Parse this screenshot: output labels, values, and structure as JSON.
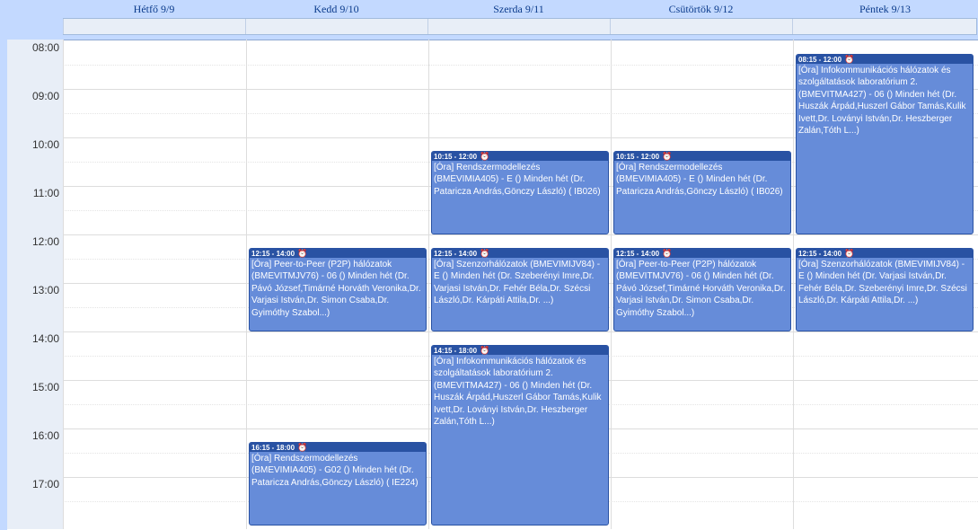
{
  "days": [
    {
      "label": "Hétfő 9/9"
    },
    {
      "label": "Kedd 9/10"
    },
    {
      "label": "Szerda 9/11"
    },
    {
      "label": "Csütörtök 9/12"
    },
    {
      "label": "Péntek 9/13"
    }
  ],
  "hours": [
    "08:00",
    "09:00",
    "10:00",
    "11:00",
    "12:00",
    "13:00",
    "14:00",
    "15:00",
    "16:00",
    "17:00"
  ],
  "events": [
    {
      "day": 4,
      "start": "08:15",
      "end": "12:00",
      "time": "08:15 - 12:00",
      "icon": "alarm-clock-icon",
      "text": "[Óra] Infokommunikációs hálózatok és szolgáltatások laboratórium 2. (BMEVITMA427) - 06 () Minden hét (Dr. Huszák Árpád,Huszerl Gábor Tamás,Kulik Ivett,Dr. Loványi István,Dr. Heszberger Zalán,Tóth L...)"
    },
    {
      "day": 2,
      "start": "10:15",
      "end": "12:00",
      "time": "10:15 - 12:00",
      "icon": "alarm-clock-icon",
      "text": "[Óra] Rendszermodellezés (BMEVIMIA405) - E () Minden hét (Dr. Pataricza András,Gönczy László) ( IB026)"
    },
    {
      "day": 3,
      "start": "10:15",
      "end": "12:00",
      "time": "10:15 - 12:00",
      "icon": "alarm-clock-icon",
      "text": "[Óra] Rendszermodellezés (BMEVIMIA405) - E () Minden hét (Dr. Pataricza András,Gönczy László) ( IB026)"
    },
    {
      "day": 1,
      "start": "12:15",
      "end": "14:00",
      "time": "12:15 - 14:00",
      "icon": "alarm-clock-icon",
      "text": "[Óra] Peer-to-Peer (P2P) hálózatok (BMEVITMJV76) - 06 () Minden hét (Dr. Pávó József,Timárné Horváth Veronika,Dr. Varjasi István,Dr. Simon Csaba,Dr. Gyimóthy Szabol...)"
    },
    {
      "day": 2,
      "start": "12:15",
      "end": "14:00",
      "time": "12:15 - 14:00",
      "icon": "alarm-clock-icon",
      "text": "[Óra] Szenzorhálózatok (BMEVIMIJV84) - E () Minden hét (Dr. Szeberényi Imre,Dr. Varjasi István,Dr. Fehér Béla,Dr. Szécsi László,Dr. Kárpáti Attila,Dr. ...)"
    },
    {
      "day": 3,
      "start": "12:15",
      "end": "14:00",
      "time": "12:15 - 14:00",
      "icon": "alarm-clock-icon",
      "text": "[Óra] Peer-to-Peer (P2P) hálózatok (BMEVITMJV76) - 06 () Minden hét (Dr. Pávó József,Timárné Horváth Veronika,Dr. Varjasi István,Dr. Simon Csaba,Dr. Gyimóthy Szabol...)"
    },
    {
      "day": 4,
      "start": "12:15",
      "end": "14:00",
      "time": "12:15 - 14:00",
      "icon": "alarm-clock-icon",
      "text": "[Óra] Szenzorhálózatok (BMEVIMIJV84) - E () Minden hét (Dr. Varjasi István,Dr. Fehér Béla,Dr. Szeberényi Imre,Dr. Szécsi László,Dr. Kárpáti Attila,Dr. ...)"
    },
    {
      "day": 2,
      "start": "14:15",
      "end": "18:00",
      "time": "14:15 - 18:00",
      "icon": "alarm-clock-icon",
      "text": "[Óra] Infokommunikációs hálózatok és szolgáltatások laboratórium 2. (BMEVITMA427) - 06 () Minden hét (Dr. Huszák Árpád,Huszerl Gábor Tamás,Kulik Ivett,Dr. Loványi István,Dr. Heszberger Zalán,Tóth L...)"
    },
    {
      "day": 1,
      "start": "16:15",
      "end": "18:00",
      "time": "16:15 - 18:00",
      "icon": "alarm-clock-icon",
      "text": "[Óra] Rendszermodellezés (BMEVIMIA405) - G02 () Minden hét (Dr. Pataricza András,Gönczy László) ( IE224)"
    }
  ],
  "colors": {
    "event_bg": "#668cd9",
    "event_header": "#2952a3",
    "header_bg": "#c3d9ff",
    "header_text": "#0c3c8c"
  }
}
